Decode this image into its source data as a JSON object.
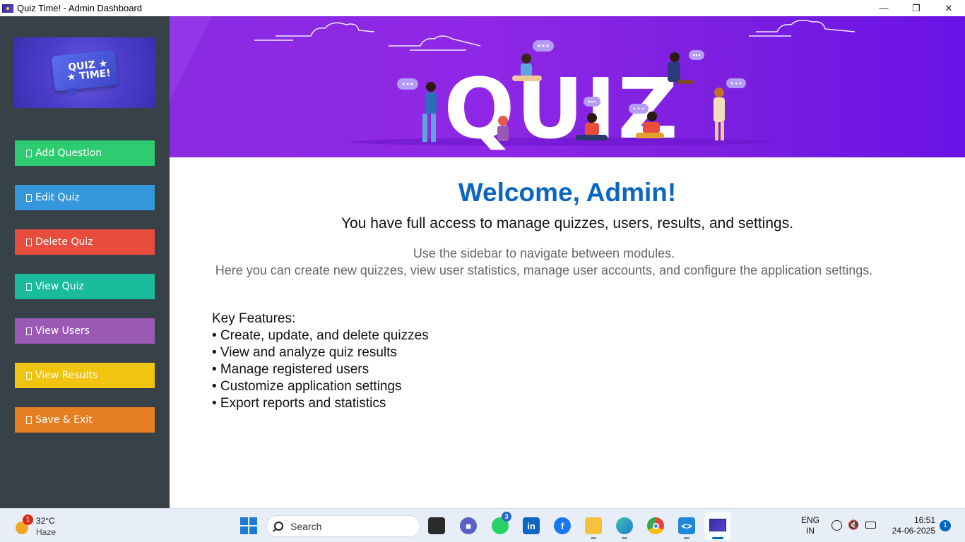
{
  "window": {
    "title": "Quiz Time! - Admin Dashboard"
  },
  "sidebar": {
    "logo_line1": "QUIZ ★",
    "logo_line2": "★ TIME!",
    "items": [
      {
        "label": "Add Question",
        "color": "#2ecc71"
      },
      {
        "label": "Edit Quiz",
        "color": "#3498db"
      },
      {
        "label": "Delete Quiz",
        "color": "#e74c3c"
      },
      {
        "label": "View Quiz",
        "color": "#1abc9c"
      },
      {
        "label": "View Users",
        "color": "#9b59b6"
      },
      {
        "label": "View Results",
        "color": "#f1c40f"
      },
      {
        "label": "Save & Exit",
        "color": "#e67e22"
      }
    ]
  },
  "banner": {
    "word": "QUIZ"
  },
  "main": {
    "welcome": "Welcome, Admin!",
    "subtitle": "You have full access to manage quizzes, users, results, and settings.",
    "desc_line1": "Use the sidebar to navigate between modules.",
    "desc_line2": "Here you can create new quizzes, view user statistics, manage user accounts, and configure the application settings.",
    "features_title": "Key Features:",
    "features": [
      "• Create, update, and delete quizzes",
      "• View and analyze quiz results",
      "• Manage registered users",
      "• Customize application settings",
      "• Export reports and statistics"
    ]
  },
  "taskbar": {
    "weather_badge": "1",
    "temperature": "32°C",
    "condition": "Haze",
    "search_placeholder": "Search",
    "whatsapp_badge": "3",
    "lang_line1": "ENG",
    "lang_line2": "IN",
    "time": "16:51",
    "date": "24-06-2025",
    "notification_count": "1"
  }
}
